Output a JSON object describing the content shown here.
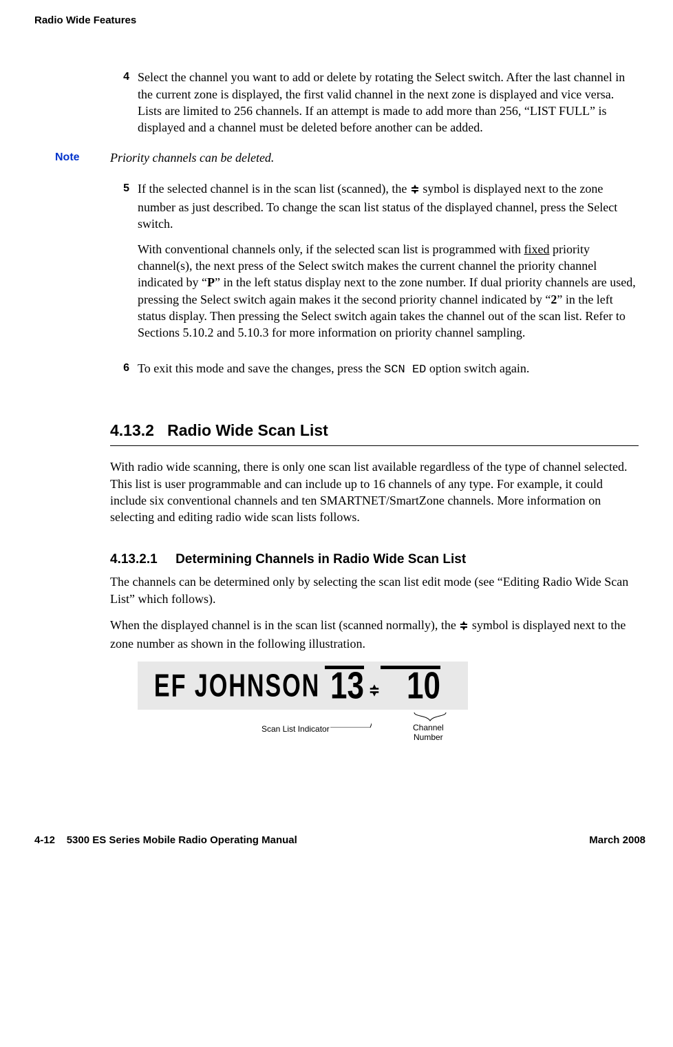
{
  "header": {
    "running_title": "Radio Wide Features"
  },
  "steps": {
    "s4_num": "4",
    "s4_body": "Select the channel you want to add or delete by rotating the Select switch. After the last channel in the current zone is displayed, the first valid channel in the next zone is displayed and vice versa. Lists are limited to 256 channels. If an attempt is made to add more than 256, “LIST FULL” is displayed and a channel must be deleted before another can be added.",
    "note_label": "Note",
    "note_body": "Priority channels can be deleted.",
    "s5_num": "5",
    "s5_pre": "If the selected channel is in the scan list (scanned), the ",
    "s5_post": " symbol is displayed next to the zone number as just described. To change the scan list status of the displayed channel, press the Select switch.",
    "s5_para2_pre": "With conventional channels only, if the selected scan list is programmed with ",
    "s5_para2_underlined": "fixed",
    "s5_para2_mid1": " priority channel(s), the next press of the Select switch makes the current channel the priority channel indicated by “",
    "s5_para2_P": "P",
    "s5_para2_mid2": "” in the left status display next to the zone number. If dual priority channels are used, pressing the Select switch again makes it the second priority channel indicated by “",
    "s5_para2_2": "2",
    "s5_para2_end": "” in the left status display. Then pressing the Select switch again takes the channel out of the scan list. Refer to Sections 5.10.2 and 5.10.3 for more information on priority channel sampling.",
    "s6_num": "6",
    "s6_pre": "To exit this mode and save the changes, press the ",
    "s6_code": "SCN ED",
    "s6_post": " option switch again."
  },
  "h2": {
    "number": "4.13.2",
    "title": "Radio Wide Scan List"
  },
  "p_rws": "With radio wide scanning, there is only one scan list available regardless of the type of channel selected. This list is user programmable and can include up to 16 channels of any type. For example, it could include six conventional channels and ten SMARTNET/SmartZone channels. More information on selecting and editing radio wide scan lists follows.",
  "h3": {
    "number": "4.13.2.1",
    "title": "Determining Channels in Radio Wide Scan List"
  },
  "p_det1": "The channels can be determined only by selecting the scan list edit mode (see “Editing Radio Wide Scan List” which follows).",
  "p_det2_pre": "When the displayed channel is in the scan list (scanned normally), the ",
  "p_det2_post": " symbol is displayed next to the zone number as shown in the following illustration.",
  "display": {
    "text": "EF JOHNSON",
    "num1": "13",
    "num2": "10",
    "callout_scan": "Scan List Indicator",
    "callout_channel_l1": "Channel",
    "callout_channel_l2": "Number"
  },
  "footer": {
    "left_page": "4-12",
    "left_title": "5300 ES Series Mobile Radio Operating Manual",
    "right": "March 2008"
  }
}
